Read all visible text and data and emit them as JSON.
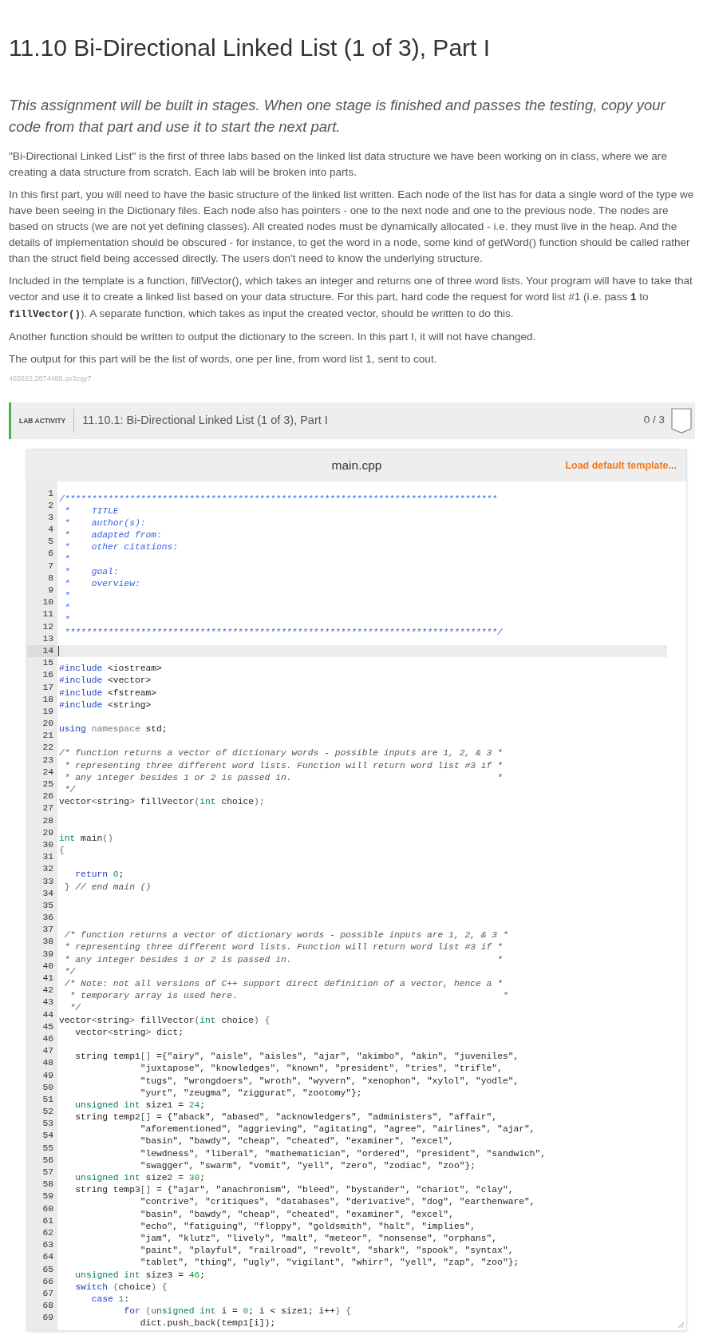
{
  "page": {
    "title": "11.10 Bi-Directional Linked List (1 of 3), Part I",
    "intro": "This assignment will be built in stages. When one stage is finished and passes the testing, copy your code from that part and use it to start the next part.",
    "paragraphs": [
      {
        "parts": [
          {
            "kind": "text",
            "text": "\"Bi-Directional Linked List\" is the first of three labs based on the linked list data structure we have been working on in class, where we are creating a data structure from scratch. Each lab will be broken into parts."
          }
        ]
      },
      {
        "parts": [
          {
            "kind": "text",
            "text": "In this first part, you will need to have the basic structure of the linked list written. Each node of the list has for data a single word of the type we have been seeing in the Dictionary files. Each node also has pointers - one to the next node and one to the previous node. The nodes are based on structs (we are not yet defining classes). All created nodes must be dynamically allocated - i.e. they must live in the heap. And the details of implementation should be obscured - for instance, to get the word in a node, some kind of getWord() function should be called rather than the struct field being accessed directly. The users don't need to know the underlying structure."
          }
        ]
      },
      {
        "parts": [
          {
            "kind": "text",
            "text": "Included in the template is a function, fillVector(), which takes an integer and returns one of three word lists. Your program will have to take that vector and use it to create a linked list based on your data structure. For this part, hard code the request for word list #1 (i.e. pass "
          },
          {
            "kind": "code",
            "text": "1"
          },
          {
            "kind": "text",
            "text": " to "
          },
          {
            "kind": "code",
            "text": "fillVector()"
          },
          {
            "kind": "text",
            "text": "). A separate function, which takes as input the created vector, should be written to do this."
          }
        ]
      },
      {
        "parts": [
          {
            "kind": "text",
            "text": "Another function should be written to output the dictionary to the screen. In this part I, it will not have changed."
          }
        ]
      },
      {
        "parts": [
          {
            "kind": "text",
            "text": "The output for this part will be the list of words, one per line, from word list 1, sent to cout."
          }
        ]
      }
    ],
    "id_code": "465922.2874488.qx3zqy7"
  },
  "lab_activity": {
    "label": "LAB ACTIVITY",
    "title": "11.10.1: Bi-Directional Linked List (1 of 3), Part I",
    "score": "0 / 3"
  },
  "editor": {
    "filename": "main.cpp",
    "load_link": "Load default template...",
    "lines": [
      {
        "number": "1",
        "active": false,
        "tokens": [
          {
            "kind": "doc",
            "text": "/********************************************************************************"
          }
        ]
      },
      {
        "number": "2",
        "active": false,
        "tokens": [
          {
            "kind": "doc",
            "text": " *    TITLE"
          }
        ]
      },
      {
        "number": "3",
        "active": false,
        "tokens": [
          {
            "kind": "doc",
            "text": " *    author(s):"
          }
        ]
      },
      {
        "number": "4",
        "active": false,
        "tokens": [
          {
            "kind": "doc",
            "text": " *    adapted from:"
          }
        ]
      },
      {
        "number": "5",
        "active": false,
        "tokens": [
          {
            "kind": "doc",
            "text": " *    other citations:"
          }
        ]
      },
      {
        "number": "6",
        "active": false,
        "tokens": [
          {
            "kind": "doc",
            "text": " *"
          }
        ]
      },
      {
        "number": "7",
        "active": false,
        "tokens": [
          {
            "kind": "doc",
            "text": " *    goal:"
          }
        ]
      },
      {
        "number": "8",
        "active": false,
        "tokens": [
          {
            "kind": "doc",
            "text": " *    overview:"
          }
        ]
      },
      {
        "number": "9",
        "active": false,
        "tokens": [
          {
            "kind": "doc",
            "text": " *"
          }
        ]
      },
      {
        "number": "10",
        "active": false,
        "tokens": [
          {
            "kind": "doc",
            "text": " *"
          }
        ]
      },
      {
        "number": "11",
        "active": false,
        "tokens": [
          {
            "kind": "doc",
            "text": " *"
          }
        ]
      },
      {
        "number": "12",
        "active": false,
        "tokens": [
          {
            "kind": "doc",
            "text": " ********************************************************************************/"
          }
        ]
      },
      {
        "number": "13",
        "active": false
      },
      {
        "number": "14",
        "active": true
      },
      {
        "number": "15",
        "active": false,
        "tokens": [
          {
            "kind": "keyword",
            "text": "#include"
          },
          {
            "kind": "plain",
            "text": " <iostream>"
          }
        ]
      },
      {
        "number": "16",
        "active": false,
        "tokens": [
          {
            "kind": "keyword",
            "text": "#include"
          },
          {
            "kind": "plain",
            "text": " <vector>"
          }
        ]
      },
      {
        "number": "17",
        "active": false,
        "tokens": [
          {
            "kind": "keyword",
            "text": "#include"
          },
          {
            "kind": "plain",
            "text": " <fstream>"
          }
        ]
      },
      {
        "number": "18",
        "active": false,
        "tokens": [
          {
            "kind": "keyword",
            "text": "#include"
          },
          {
            "kind": "plain",
            "text": " <string>"
          }
        ]
      },
      {
        "number": "19",
        "active": false
      },
      {
        "number": "20",
        "active": false,
        "tokens": [
          {
            "kind": "keyword",
            "text": "using"
          },
          {
            "kind": "muted",
            "text": " namespace"
          },
          {
            "kind": "plain",
            "text": " std;"
          }
        ]
      },
      {
        "number": "21",
        "active": false
      },
      {
        "number": "22",
        "active": false,
        "tokens": [
          {
            "kind": "comment",
            "text": "/* function returns a vector of dictionary words - possible inputs are 1, 2, & 3 *"
          }
        ]
      },
      {
        "number": "23",
        "active": false,
        "tokens": [
          {
            "kind": "comment",
            "text": " * representing three different word lists. Function will return word list #3 if *"
          }
        ]
      },
      {
        "number": "24",
        "active": false,
        "tokens": [
          {
            "kind": "comment",
            "text": " * any integer besides 1 or 2 is passed in.                                      *"
          }
        ]
      },
      {
        "number": "25",
        "active": false,
        "tokens": [
          {
            "kind": "comment",
            "text": " */"
          }
        ]
      },
      {
        "number": "26",
        "active": false,
        "tokens": [
          {
            "kind": "plain",
            "text": "vector"
          },
          {
            "kind": "punct",
            "text": "<"
          },
          {
            "kind": "plain",
            "text": "string"
          },
          {
            "kind": "punct",
            "text": ">"
          },
          {
            "kind": "plain",
            "text": " fillVector"
          },
          {
            "kind": "punct",
            "text": "("
          },
          {
            "kind": "type",
            "text": "int"
          },
          {
            "kind": "plain",
            "text": " choice"
          },
          {
            "kind": "punct",
            "text": ");"
          }
        ]
      },
      {
        "number": "27",
        "active": false
      },
      {
        "number": "28",
        "active": false
      },
      {
        "number": "29",
        "active": false,
        "tokens": [
          {
            "kind": "type",
            "text": "int"
          },
          {
            "kind": "plain",
            "text": " main"
          },
          {
            "kind": "punct",
            "text": "()"
          }
        ]
      },
      {
        "number": "30",
        "active": false,
        "tokens": [
          {
            "kind": "punct",
            "text": "{"
          }
        ]
      },
      {
        "number": "31",
        "active": false
      },
      {
        "number": "32",
        "active": false,
        "tokens": [
          {
            "kind": "keyword",
            "text": "   return"
          },
          {
            "kind": "number",
            "text": " 0"
          },
          {
            "kind": "plain",
            "text": ";"
          }
        ]
      },
      {
        "number": "33",
        "active": false,
        "tokens": [
          {
            "kind": "punct",
            "text": " }"
          },
          {
            "kind": "comment",
            "text": " // end main ()"
          }
        ]
      },
      {
        "number": "34",
        "active": false
      },
      {
        "number": "35",
        "active": false
      },
      {
        "number": "36",
        "active": false
      },
      {
        "number": "37",
        "active": false,
        "tokens": [
          {
            "kind": "comment",
            "text": " /* function returns a vector of dictionary words - possible inputs are 1, 2, & 3 *"
          }
        ]
      },
      {
        "number": "38",
        "active": false,
        "tokens": [
          {
            "kind": "comment",
            "text": " * representing three different word lists. Function will return word list #3 if *"
          }
        ]
      },
      {
        "number": "39",
        "active": false,
        "tokens": [
          {
            "kind": "comment",
            "text": " * any integer besides 1 or 2 is passed in.                                      *"
          }
        ]
      },
      {
        "number": "40",
        "active": false,
        "tokens": [
          {
            "kind": "comment",
            "text": " */"
          }
        ]
      },
      {
        "number": "41",
        "active": false,
        "tokens": [
          {
            "kind": "comment",
            "text": " /* Note: not all versions of C++ support direct definition of a vector, hence a *"
          }
        ]
      },
      {
        "number": "42",
        "active": false,
        "tokens": [
          {
            "kind": "comment",
            "text": "  * temporary array is used here.                                                 *"
          }
        ]
      },
      {
        "number": "43",
        "active": false,
        "tokens": [
          {
            "kind": "comment",
            "text": "  */"
          }
        ]
      },
      {
        "number": "44",
        "active": false,
        "tokens": [
          {
            "kind": "plain",
            "text": "vector"
          },
          {
            "kind": "punct",
            "text": "<"
          },
          {
            "kind": "plain",
            "text": "string"
          },
          {
            "kind": "punct",
            "text": ">"
          },
          {
            "kind": "plain",
            "text": " fillVector"
          },
          {
            "kind": "punct",
            "text": "("
          },
          {
            "kind": "type",
            "text": "int"
          },
          {
            "kind": "plain",
            "text": " choice"
          },
          {
            "kind": "punct",
            "text": ") {"
          }
        ]
      },
      {
        "number": "45",
        "active": false,
        "tokens": [
          {
            "kind": "plain",
            "text": "   vector"
          },
          {
            "kind": "punct",
            "text": "<"
          },
          {
            "kind": "plain",
            "text": "string"
          },
          {
            "kind": "punct",
            "text": ">"
          },
          {
            "kind": "plain",
            "text": " dict;"
          }
        ]
      },
      {
        "number": "46",
        "active": false
      },
      {
        "number": "47",
        "active": false,
        "tokens": [
          {
            "kind": "plain",
            "text": "   string temp1"
          },
          {
            "kind": "punct",
            "text": "[]"
          },
          {
            "kind": "plain",
            "text": " ={\"airy\", \"aisle\", \"aisles\", \"ajar\", \"akimbo\", \"akin\", \"juveniles\","
          }
        ]
      },
      {
        "number": "48",
        "active": false,
        "tokens": [
          {
            "kind": "plain",
            "text": "               \"juxtapose\", \"knowledges\", \"known\", \"president\", \"tries\", \"trifle\","
          }
        ]
      },
      {
        "number": "49",
        "active": false,
        "tokens": [
          {
            "kind": "plain",
            "text": "               \"tugs\", \"wrongdoers\", \"wroth\", \"wyvern\", \"xenophon\", \"xylol\", \"yodle\","
          }
        ]
      },
      {
        "number": "50",
        "active": false,
        "tokens": [
          {
            "kind": "plain",
            "text": "               \"yurt\", \"zeugma\", \"ziggurat\", \"zootomy\"};"
          }
        ]
      },
      {
        "number": "51",
        "active": false,
        "tokens": [
          {
            "kind": "type",
            "text": "   unsigned int"
          },
          {
            "kind": "plain",
            "text": " size1 = "
          },
          {
            "kind": "number",
            "text": "24"
          },
          {
            "kind": "plain",
            "text": ";"
          }
        ]
      },
      {
        "number": "52",
        "active": false,
        "tokens": [
          {
            "kind": "plain",
            "text": "   string temp2"
          },
          {
            "kind": "punct",
            "text": "[]"
          },
          {
            "kind": "plain",
            "text": " = {\"aback\", \"abased\", \"acknowledgers\", \"administers\", \"affair\","
          }
        ]
      },
      {
        "number": "53",
        "active": false,
        "tokens": [
          {
            "kind": "plain",
            "text": "               \"aforementioned\", \"aggrieving\", \"agitating\", \"agree\", \"airlines\", \"ajar\","
          }
        ]
      },
      {
        "number": "54",
        "active": false,
        "tokens": [
          {
            "kind": "plain",
            "text": "               \"basin\", \"bawdy\", \"cheap\", \"cheated\", \"examiner\", \"excel\","
          }
        ]
      },
      {
        "number": "55",
        "active": false,
        "tokens": [
          {
            "kind": "plain",
            "text": "               \"lewdness\", \"liberal\", \"mathematician\", \"ordered\", \"president\", \"sandwich\","
          }
        ]
      },
      {
        "number": "56",
        "active": false,
        "tokens": [
          {
            "kind": "plain",
            "text": "               \"swagger\", \"swarm\", \"vomit\", \"yell\", \"zero\", \"zodiac\", \"zoo\"};"
          }
        ]
      },
      {
        "number": "57",
        "active": false,
        "tokens": [
          {
            "kind": "type",
            "text": "   unsigned int"
          },
          {
            "kind": "plain",
            "text": " size2 = "
          },
          {
            "kind": "number",
            "text": "30"
          },
          {
            "kind": "plain",
            "text": ";"
          }
        ]
      },
      {
        "number": "58",
        "active": false,
        "tokens": [
          {
            "kind": "plain",
            "text": "   string temp3"
          },
          {
            "kind": "punct",
            "text": "[]"
          },
          {
            "kind": "plain",
            "text": " = {\"ajar\", \"anachronism\", \"bleed\", \"bystander\", \"chariot\", \"clay\","
          }
        ]
      },
      {
        "number": "59",
        "active": false,
        "tokens": [
          {
            "kind": "plain",
            "text": "               \"contrive\", \"critiques\", \"databases\", \"derivative\", \"dog\", \"earthenware\","
          }
        ]
      },
      {
        "number": "60",
        "active": false,
        "tokens": [
          {
            "kind": "plain",
            "text": "               \"basin\", \"bawdy\", \"cheap\", \"cheated\", \"examiner\", \"excel\","
          }
        ]
      },
      {
        "number": "61",
        "active": false,
        "tokens": [
          {
            "kind": "plain",
            "text": "               \"echo\", \"fatiguing\", \"floppy\", \"goldsmith\", \"halt\", \"implies\","
          }
        ]
      },
      {
        "number": "62",
        "active": false,
        "tokens": [
          {
            "kind": "plain",
            "text": "               \"jam\", \"klutz\", \"lively\", \"malt\", \"meteor\", \"nonsense\", \"orphans\","
          }
        ]
      },
      {
        "number": "63",
        "active": false,
        "tokens": [
          {
            "kind": "plain",
            "text": "               \"paint\", \"playful\", \"railroad\", \"revolt\", \"shark\", \"spook\", \"syntax\","
          }
        ]
      },
      {
        "number": "64",
        "active": false,
        "tokens": [
          {
            "kind": "plain",
            "text": "               \"tablet\", \"thing\", \"ugly\", \"vigilant\", \"whirr\", \"yell\", \"zap\", \"zoo\"};"
          }
        ]
      },
      {
        "number": "65",
        "active": false,
        "tokens": [
          {
            "kind": "type",
            "text": "   unsigned int"
          },
          {
            "kind": "plain",
            "text": " size3 = "
          },
          {
            "kind": "number",
            "text": "46"
          },
          {
            "kind": "plain",
            "text": ";"
          }
        ]
      },
      {
        "number": "66",
        "active": false,
        "tokens": [
          {
            "kind": "keyword",
            "text": "   switch"
          },
          {
            "kind": "punct",
            "text": " ("
          },
          {
            "kind": "plain",
            "text": "choice"
          },
          {
            "kind": "punct",
            "text": ") {"
          }
        ]
      },
      {
        "number": "67",
        "active": false,
        "tokens": [
          {
            "kind": "keyword",
            "text": "      case"
          },
          {
            "kind": "number",
            "text": " 1"
          },
          {
            "kind": "plain",
            "text": ":"
          }
        ]
      },
      {
        "number": "68",
        "active": false,
        "tokens": [
          {
            "kind": "keyword",
            "text": "            for"
          },
          {
            "kind": "punct",
            "text": " ("
          },
          {
            "kind": "type",
            "text": "unsigned int"
          },
          {
            "kind": "plain",
            "text": " i = "
          },
          {
            "kind": "number",
            "text": "0"
          },
          {
            "kind": "plain",
            "text": "; i < size1; i++"
          },
          {
            "kind": "punct",
            "text": ") {"
          }
        ]
      },
      {
        "number": "69",
        "active": false,
        "tokens": [
          {
            "kind": "plain",
            "text": "               dict.push_back(temp1[i]);"
          }
        ]
      }
    ]
  }
}
